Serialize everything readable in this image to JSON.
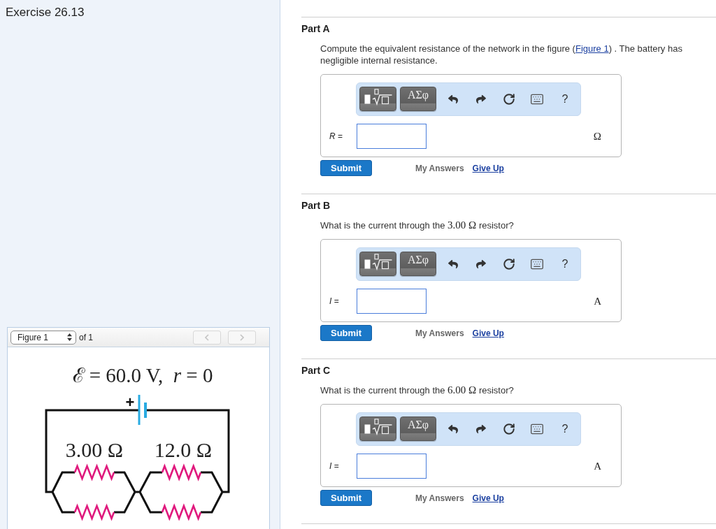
{
  "exercise": {
    "title": "Exercise 26.13"
  },
  "figure": {
    "select": "Figure 1",
    "count": "of 1",
    "previous": {
      "disabled": true
    },
    "next": {
      "disabled": true
    },
    "equation": "ℰ = 60.0 V,  *r* = 0",
    "positive_sign": "+",
    "resistor_labels": [
      "3.00 Ω",
      "12.0 Ω"
    ]
  },
  "parts": [
    {
      "title": "Part A",
      "question": [
        {
          "kind": "text",
          "text": "Compute the equivalent resistance of the network in the figure ("
        },
        {
          "kind": "link",
          "text": "Figure 1"
        },
        {
          "kind": "text",
          "text": ") . The battery has negligible internal resistance."
        }
      ],
      "toolbar": [
        {
          "kind": "template"
        },
        {
          "kind": "greek",
          "label": "ΑΣφ"
        },
        {
          "kind": "undo"
        },
        {
          "kind": "redo"
        },
        {
          "kind": "reset"
        },
        {
          "kind": "keyboard"
        },
        {
          "kind": "help",
          "label": "?"
        }
      ],
      "answer": {
        "label": "*R* =",
        "unit": "Ω"
      },
      "submit": "Submit",
      "my_answers": "My Answers",
      "give_up": "Give Up"
    },
    {
      "title": "Part B",
      "question": [
        {
          "kind": "text",
          "text": "What is the current through the "
        },
        {
          "kind": "math",
          "text": "3.00 Ω"
        },
        {
          "kind": "text",
          "text": " resistor?"
        }
      ],
      "toolbar": [
        {
          "kind": "template"
        },
        {
          "kind": "greek",
          "label": "ΑΣφ"
        },
        {
          "kind": "undo"
        },
        {
          "kind": "redo"
        },
        {
          "kind": "reset"
        },
        {
          "kind": "keyboard"
        },
        {
          "kind": "help",
          "label": "?"
        }
      ],
      "answer": {
        "label": "*I* =",
        "unit": "A"
      },
      "submit": "Submit",
      "my_answers": "My Answers",
      "give_up": "Give Up"
    },
    {
      "title": "Part C",
      "question": [
        {
          "kind": "text",
          "text": "What is the current through the "
        },
        {
          "kind": "math",
          "text": "6.00 Ω"
        },
        {
          "kind": "text",
          "text": " resistor?"
        }
      ],
      "toolbar": [
        {
          "kind": "template"
        },
        {
          "kind": "greek",
          "label": "ΑΣφ"
        },
        {
          "kind": "undo"
        },
        {
          "kind": "redo"
        },
        {
          "kind": "reset"
        },
        {
          "kind": "keyboard"
        },
        {
          "kind": "help",
          "label": "?"
        }
      ],
      "answer": {
        "label": "*I* =",
        "unit": "A"
      },
      "submit": "Submit",
      "my_answers": "My Answers",
      "give_up": "Give Up"
    }
  ]
}
